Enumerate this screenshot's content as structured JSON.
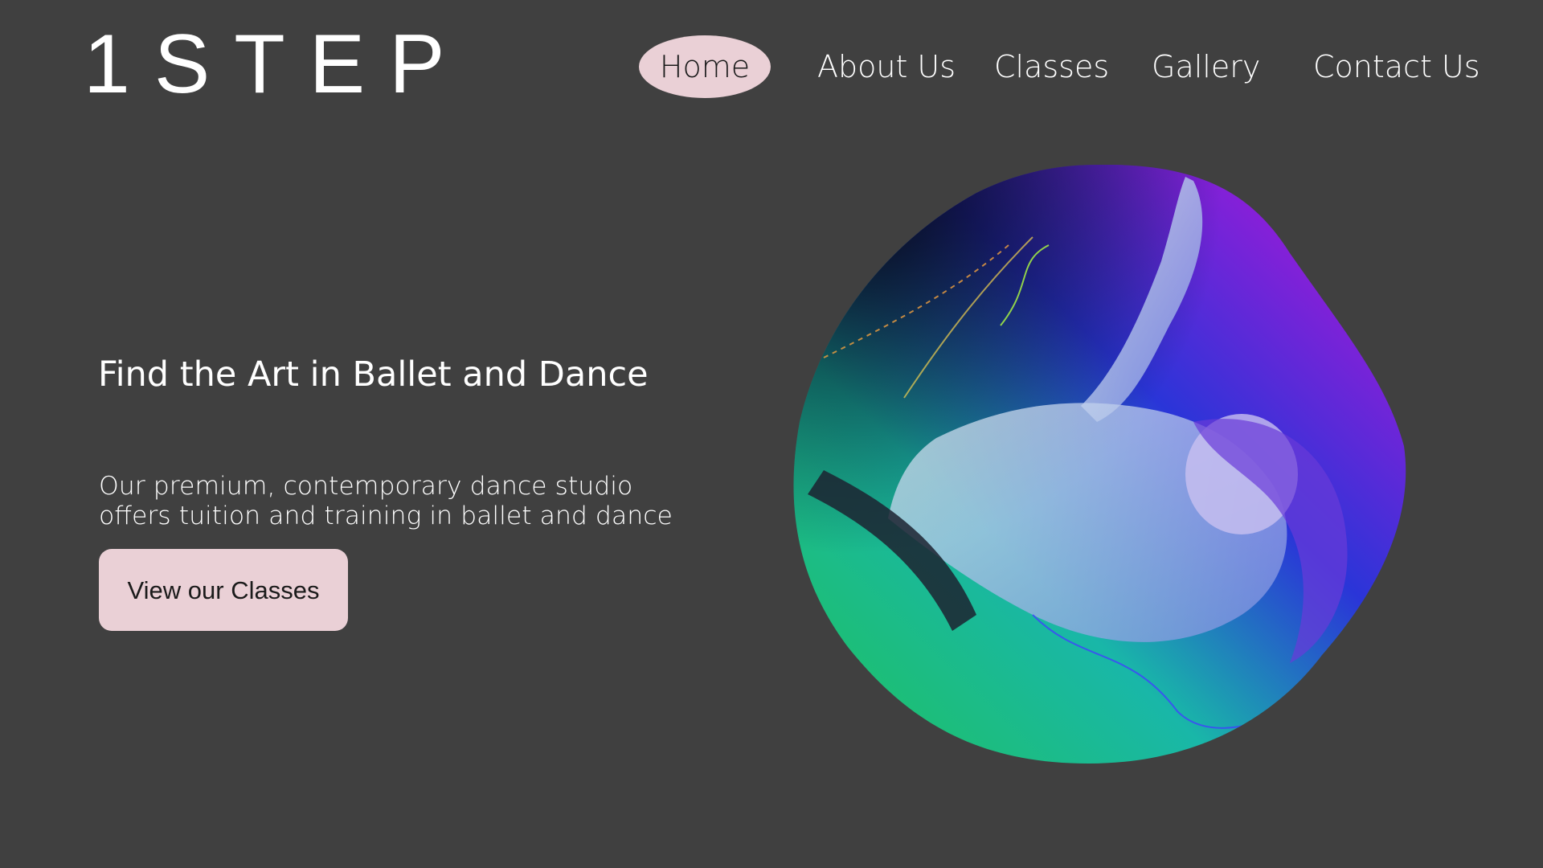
{
  "brand": {
    "logo_text": "1STEP"
  },
  "nav": {
    "items": [
      {
        "label": "Home",
        "active": true
      },
      {
        "label": "About Us",
        "active": false
      },
      {
        "label": "Classes",
        "active": false
      },
      {
        "label": "Gallery",
        "active": false
      },
      {
        "label": "Contact Us",
        "active": false
      }
    ]
  },
  "hero": {
    "title": "Find the Art in Ballet and Dance",
    "description_lines": [
      "Our premium, contemporary dance studio",
      "offers tuition and training in ballet and dance"
    ],
    "cta_label": "View our Classes",
    "image_icon": "dancer-photo"
  },
  "colors": {
    "background": "#404040",
    "accent_pink": "#ead0d6",
    "gradient_green": "#1fc25a",
    "gradient_teal": "#19b7a8",
    "gradient_blue": "#2a35d8",
    "gradient_purple": "#8a1fd8",
    "gradient_dark": "#050510"
  }
}
